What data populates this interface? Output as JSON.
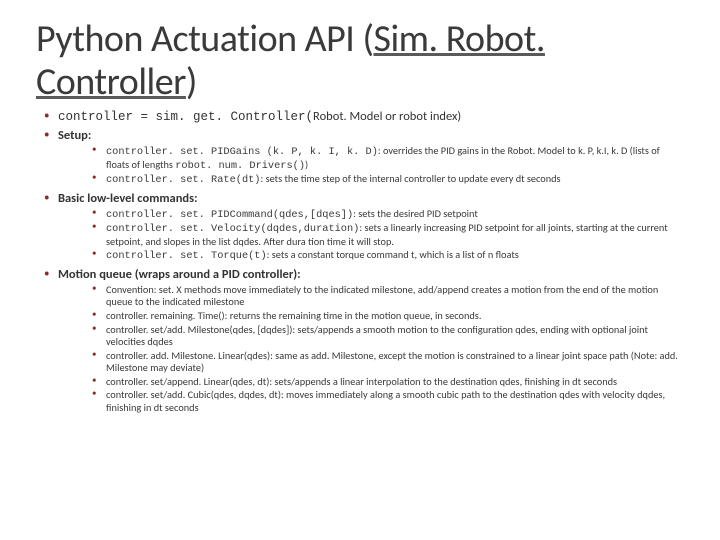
{
  "title_pre": "Python Actuation API (",
  "title_link": "Sim. Robot. Controller",
  "title_post": ")",
  "b1": {
    "code": "controller = sim. get. Controller(",
    "tail": "Robot. Model or robot index)"
  },
  "b2": {
    "head": "Setup:",
    "s1_code": "controller. set. PIDGains (k. P, k. I, k. D)",
    "s1_txt": ": overrides the PID gains in the Robot. Model to k. P, k.I, k. D (lists of floats of lengths ",
    "s1_code2": "robot. num. Drivers()",
    "s1_tail": ")",
    "s2_code": "controller. set. Rate(dt)",
    "s2_txt": ": sets the time step of the internal controller to update every dt seconds"
  },
  "b3": {
    "head": "Basic low-level commands:",
    "s1_code": "controller. set. PIDCommand(qdes,[dqes])",
    "s1_txt": ": sets the desired PID setpoint",
    "s2_code": "controller. set. Velocity(dqdes,duration)",
    "s2_txt": ": sets a linearly increasing PID setpoint for all joints, starting at the current setpoint, and slopes in the list dqdes. After dura tion time it will stop.",
    "s3_code": "controller. set. Torque(t)",
    "s3_txt": ": sets a constant torque command t, which is a list of n floats"
  },
  "b4": {
    "head": "Motion queue (wraps around a PID controller):",
    "s1": "Convention: set. X methods move immediately to the indicated milestone, add/append creates a motion from the end of the motion queue to the indicated milestone",
    "s2": "controller. remaining. Time(): returns the remaining time in the motion queue, in seconds.",
    "s3": "controller. set/add. Milestone(qdes, [dqdes]): sets/appends a smooth motion to the configuration qdes, ending with optional joint velocities dqdes",
    "s4": "controller. add. Milestone. Linear(qdes): same as add. Milestone, except the motion is constrained to a linear joint space path (Note: add. Milestone may deviate)",
    "s5": "controller. set/append. Linear(qdes, dt): sets/appends a linear interpolation to the destination qdes, finishing in dt seconds",
    "s6": "controller. set/add. Cubic(qdes, dqdes, dt): moves immediately along a smooth cubic path to the destination qdes with velocity dqdes, finishing in dt seconds"
  }
}
